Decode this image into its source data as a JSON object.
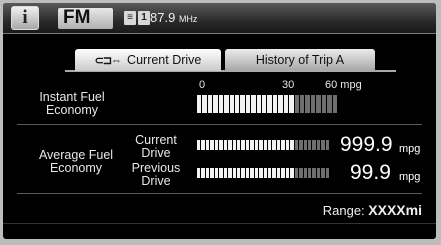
{
  "header": {
    "info_icon": "i",
    "band": "FM",
    "preset_icons": [
      "≡",
      "1"
    ],
    "frequency": "87.9",
    "frequency_unit": "MHz"
  },
  "tabs": [
    {
      "label": "Current Drive",
      "icon": "chain-link-icon",
      "selected": true
    },
    {
      "label": "History of Trip A",
      "selected": false
    }
  ],
  "instant": {
    "label_line1": "Instant Fuel",
    "label_line2": "Economy",
    "scale": [
      "0",
      "30",
      "60 mpg"
    ],
    "level_fraction": 0.68
  },
  "average": {
    "label_line1": "Average Fuel",
    "label_line2": "Economy",
    "rows": [
      {
        "label_line1": "Current",
        "label_line2": "Drive",
        "value": "999.9",
        "unit": "mpg",
        "level_fraction": 0.72
      },
      {
        "label_line1": "Previous",
        "label_line2": "Drive",
        "value": "99.9",
        "unit": "mpg",
        "level_fraction": 0.72
      }
    ]
  },
  "range": {
    "label": "Range:",
    "value": "XXXXmi"
  },
  "colors": {
    "bar_on": "#f2f2f2",
    "bar_off": "#6e6e6e",
    "background": "#000000"
  }
}
